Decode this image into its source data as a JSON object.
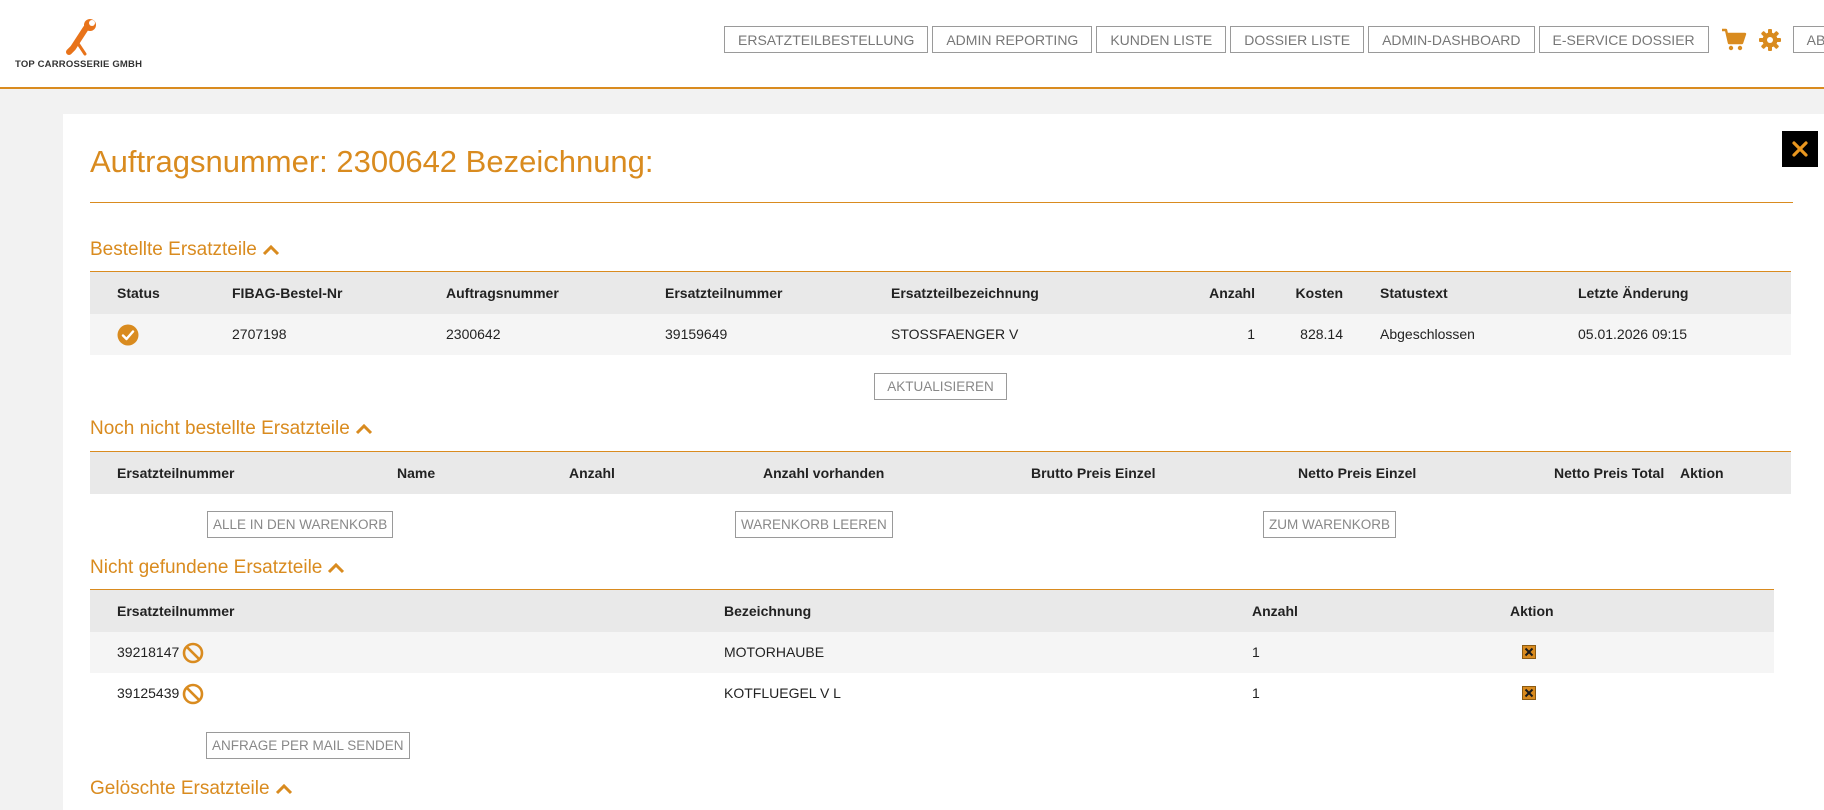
{
  "header": {
    "company": "TOP CARROSSERIE GMBH",
    "nav": [
      "ERSATZTEILBESTELLUNG",
      "ADMIN REPORTING",
      "KUNDEN LISTE",
      "DOSSIER LISTE",
      "ADMIN-DASHBOARD",
      "E-SERVICE DOSSIER"
    ],
    "logout": "ABMELDEN"
  },
  "page": {
    "title": "Auftragsnummer: 2300642 Bezeichnung:"
  },
  "ordered": {
    "title": "Bestellte Ersatzteile",
    "columns": [
      "Status",
      "FIBAG-Bestel-Nr",
      "Auftragsnummer",
      "Ersatzteilnummer",
      "Ersatzteilbezeichnung",
      "Anzahl",
      "Kosten",
      "Statustext",
      "Letzte Änderung"
    ],
    "rows": [
      {
        "fibag": "2707198",
        "auftrag": "2300642",
        "teilnummer": "39159649",
        "bezeichnung": "STOSSFAENGER V",
        "anzahl": "1",
        "kosten": "828.14",
        "statustext": "Abgeschlossen",
        "aenderung": "05.01.2026 09:15"
      }
    ],
    "refresh_label": "AKTUALISIEREN"
  },
  "not_ordered": {
    "title": "Noch nicht bestellte Ersatzteile",
    "columns": [
      "Ersatzteilnummer",
      "Name",
      "Anzahl",
      "Anzahl vorhanden",
      "Brutto Preis Einzel",
      "Netto Preis Einzel",
      "Netto Preis Total",
      "Aktion"
    ],
    "all_to_cart_label": "ALLE IN DEN WARENKORB",
    "empty_cart_label": "WARENKORB LEEREN",
    "to_cart_label": "ZUM WARENKORB"
  },
  "not_found": {
    "title": "Nicht gefundene Ersatzteile",
    "columns": [
      "Ersatzteilnummer",
      "Bezeichnung",
      "Anzahl",
      "Aktion"
    ],
    "rows": [
      {
        "teilnummer": "39218147",
        "bezeichnung": "MOTORHAUBE",
        "anzahl": "1"
      },
      {
        "teilnummer": "39125439",
        "bezeichnung": "KOTFLUEGEL V L",
        "anzahl": "1"
      }
    ],
    "mail_label": "ANFRAGE PER MAIL SENDEN"
  },
  "deleted": {
    "title": "Gelöschte Ersatzteile"
  },
  "colors": {
    "accent": "#d98b1f",
    "header_bg": "#ffffff",
    "table_header_bg": "#e9e9e9"
  }
}
